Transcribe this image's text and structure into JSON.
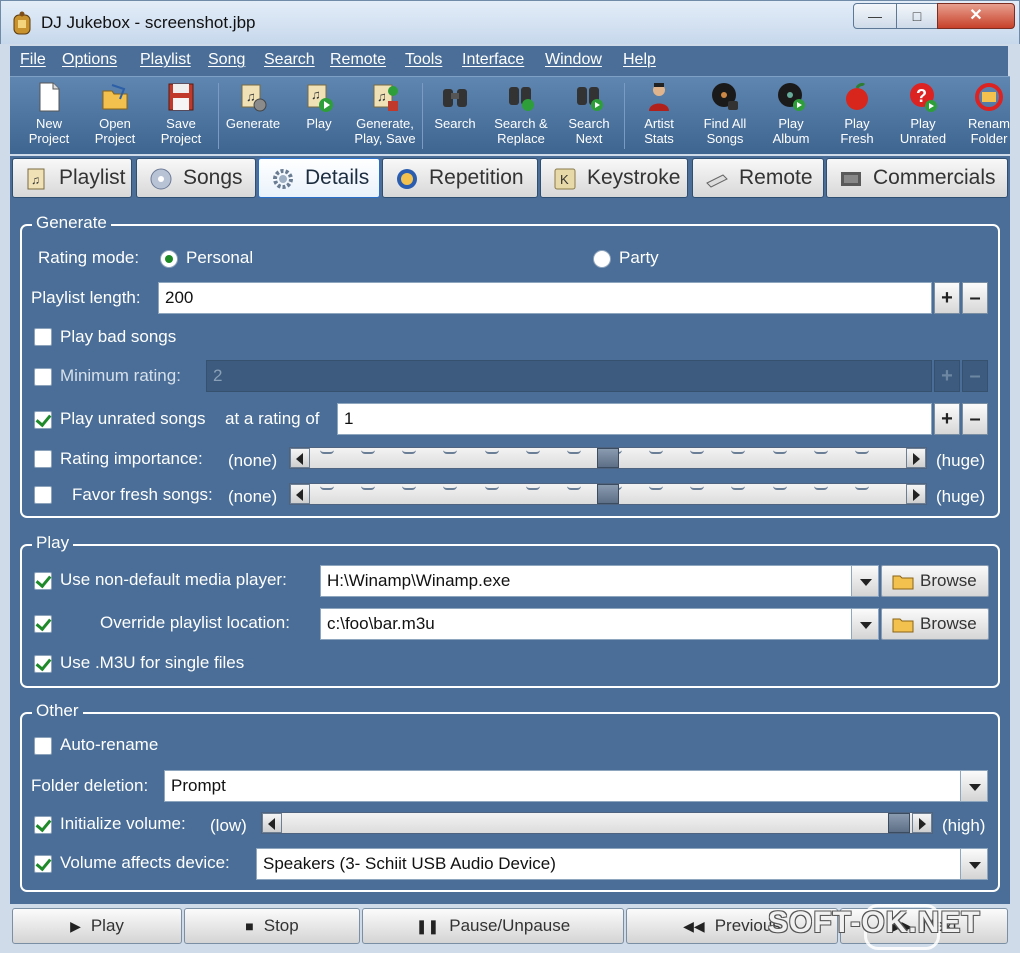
{
  "window": {
    "title": "DJ Jukebox - screenshot.jbp",
    "minimize": "—",
    "maximize": "□",
    "close": "✕"
  },
  "menu": [
    "File",
    "Options",
    "Playlist",
    "Song",
    "Search",
    "Remote",
    "Tools",
    "Interface",
    "Window",
    "Help"
  ],
  "toolbar": [
    {
      "label": "New\nProject",
      "icon": "new-document-icon"
    },
    {
      "label": "Open\nProject",
      "icon": "open-folder-icon"
    },
    {
      "label": "Save\nProject",
      "icon": "save-disk-icon"
    },
    {
      "label": "Generate",
      "icon": "generate-gear-icon"
    },
    {
      "label": "Play",
      "icon": "play-icon"
    },
    {
      "label": "Generate,\nPlay, Save",
      "icon": "generate-play-save-icon"
    },
    {
      "label": "Search",
      "icon": "binoculars-icon"
    },
    {
      "label": "Search &\nReplace",
      "icon": "search-replace-icon"
    },
    {
      "label": "Search\nNext",
      "icon": "search-next-icon"
    },
    {
      "label": "Artist\nStats",
      "icon": "artist-icon"
    },
    {
      "label": "Find All\nSongs",
      "icon": "vinyl-search-icon"
    },
    {
      "label": "Play\nAlbum",
      "icon": "vinyl-play-icon"
    },
    {
      "label": "Play\nFresh",
      "icon": "apple-icon"
    },
    {
      "label": "Play\nUnrated",
      "icon": "question-icon"
    },
    {
      "label": "Renam\nFolder",
      "icon": "rename-folder-icon"
    }
  ],
  "tabs": [
    {
      "label": "Playlist",
      "active": false
    },
    {
      "label": "Songs",
      "active": false
    },
    {
      "label": "Details",
      "active": true
    },
    {
      "label": "Repetition",
      "active": false
    },
    {
      "label": "Keystroke",
      "active": false
    },
    {
      "label": "Remote",
      "active": false
    },
    {
      "label": "Commercials",
      "active": false
    }
  ],
  "generate": {
    "legend": "Generate",
    "rating_mode_label": "Rating mode:",
    "rating_personal": "Personal",
    "rating_party": "Party",
    "playlist_length_label": "Playlist length:",
    "playlist_length_value": "200",
    "play_bad_songs": "Play bad songs",
    "min_rating_label": "Minimum rating:",
    "min_rating_value": "2",
    "play_unrated_label": "Play unrated songs",
    "at_rating_label": "at a rating of",
    "unrated_rating_value": "1",
    "rating_importance_label": "Rating importance:",
    "favor_fresh_label": "Favor fresh songs:",
    "none_label": "(none)",
    "huge_label": "(huge)",
    "rating_importance_level": 0.5,
    "favor_fresh_level": 0.5,
    "plus": "+",
    "minus": "–"
  },
  "play": {
    "legend": "Play",
    "non_default_label": "Use non-default media player:",
    "player_path": "H:\\Winamp\\Winamp.exe",
    "override_label": "Override playlist location:",
    "playlist_path": "c:\\foo\\bar.m3u",
    "browse": "Browse",
    "m3u_label": "Use .M3U for single files"
  },
  "other": {
    "legend": "Other",
    "auto_rename": "Auto-rename",
    "folder_deletion_label": "Folder deletion:",
    "folder_deletion_value": "Prompt",
    "init_volume_label": "Initialize volume:",
    "low_label": "(low)",
    "high_label": "(high)",
    "init_volume_level": 1.0,
    "volume_device_label": "Volume affects device:",
    "device_value": "Speakers (3- Schiit USB Audio Device)"
  },
  "bottom": {
    "play": "Play",
    "stop": "Stop",
    "pause": "Pause/Unpause",
    "previous": "Previous",
    "next": "Next"
  },
  "watermark": "SOFT-OK.NET",
  "colors": {
    "panel": "#4a6e97",
    "accent_check": "#1f8a2a",
    "titlebar": "#c7d8ec"
  }
}
